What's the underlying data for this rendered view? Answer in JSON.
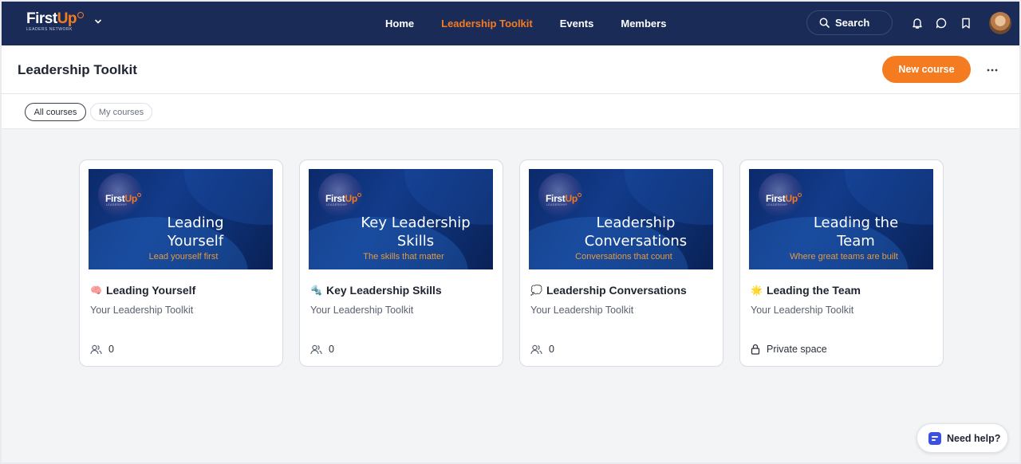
{
  "nav": {
    "logo_main": "First",
    "logo_accent": "Up",
    "logo_sub": "LEADERS NETWORK",
    "links": [
      {
        "label": "Home",
        "active": false
      },
      {
        "label": "Leadership Toolkit",
        "active": true
      },
      {
        "label": "Events",
        "active": false
      },
      {
        "label": "Members",
        "active": false
      }
    ],
    "search_label": "Search"
  },
  "header": {
    "title": "Leadership Toolkit",
    "new_course_label": "New course"
  },
  "filters": {
    "all": "All courses",
    "mine": "My courses"
  },
  "cards": [
    {
      "thumb_logo": "First",
      "thumb_logo_accent": "Up",
      "thumb_logo_sub": "LEADERSHIP",
      "thumb_title_1": "Leading",
      "thumb_title_2": "Yourself",
      "thumb_tagline": "Lead yourself first",
      "emoji": "🧠",
      "title": "Leading Yourself",
      "subtitle": "Your Leadership Toolkit",
      "footer": "0",
      "footer_icon": "members-icon"
    },
    {
      "thumb_logo": "First",
      "thumb_logo_accent": "Up",
      "thumb_logo_sub": "LEADERSHIP",
      "thumb_title_1": "Key Leadership",
      "thumb_title_2": "Skills",
      "thumb_tagline": "The skills that matter",
      "emoji": "🔩",
      "title": "Key Leadership Skills",
      "subtitle": "Your Leadership Toolkit",
      "footer": "0",
      "footer_icon": "members-icon"
    },
    {
      "thumb_logo": "First",
      "thumb_logo_accent": "Up",
      "thumb_logo_sub": "LEADERSHIP",
      "thumb_title_1": "Leadership",
      "thumb_title_2": "Conversations",
      "thumb_tagline": "Conversations that count",
      "emoji": "💭",
      "title": "Leadership Conversations",
      "subtitle": "Your Leadership Toolkit",
      "footer": "0",
      "footer_icon": "members-icon"
    },
    {
      "thumb_logo": "First",
      "thumb_logo_accent": "Up",
      "thumb_logo_sub": "LEADERSHIP",
      "thumb_title_1": "Leading the",
      "thumb_title_2": "Team",
      "thumb_tagline": "Where great teams are built",
      "emoji": "🌟",
      "title": "Leading the Team",
      "subtitle": "Your Leadership Toolkit",
      "footer": "Private space",
      "footer_icon": "lock-icon"
    }
  ],
  "help": {
    "label": "Need help?"
  },
  "colors": {
    "nav_bg": "#1b2b58",
    "accent": "#f47b20",
    "page_bg": "#f3f4f6"
  }
}
